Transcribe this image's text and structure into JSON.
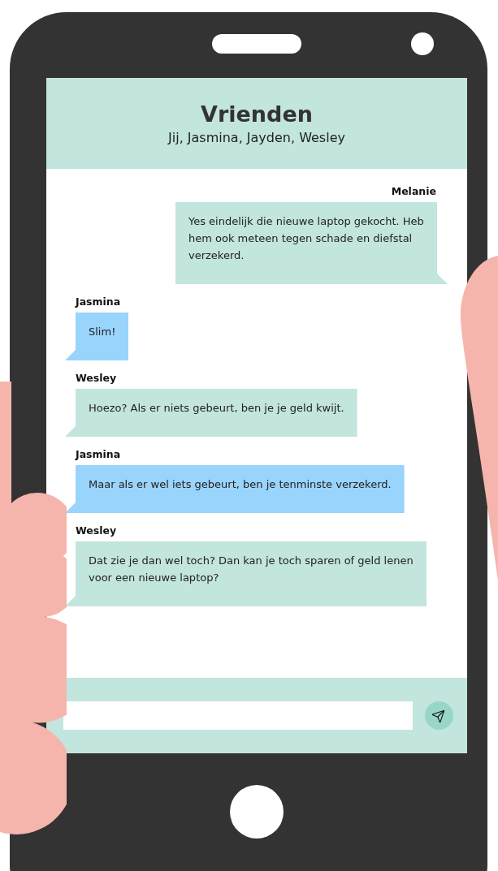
{
  "header": {
    "title": "Vrienden",
    "members": "Jij, Jasmina, Jayden, Wesley"
  },
  "messages": [
    {
      "sender": "Melanie",
      "text": "Yes eindelijk die nieuwe laptop gekocht. Heb hem ook meteen tegen schade en diefstal verzekerd.",
      "kind": "sent",
      "color": "#c2e5de"
    },
    {
      "sender": "Jasmina",
      "text": "Slim!",
      "kind": "received",
      "color": "#99d4fd"
    },
    {
      "sender": "Wesley",
      "text": "Hoezo? Als er niets gebeurt, ben je je geld kwijt.",
      "kind": "received",
      "color": "#c2e5de"
    },
    {
      "sender": "Jasmina",
      "text": "Maar als er wel iets gebeurt, ben je tenminste verzekerd.",
      "kind": "received",
      "color": "#99d4fd"
    },
    {
      "sender": "Wesley",
      "text": "Dat zie je dan wel toch? Dan kan je toch sparen of geld lenen voor een nieuwe laptop?",
      "kind": "received",
      "color": "#c2e5de"
    }
  ]
}
